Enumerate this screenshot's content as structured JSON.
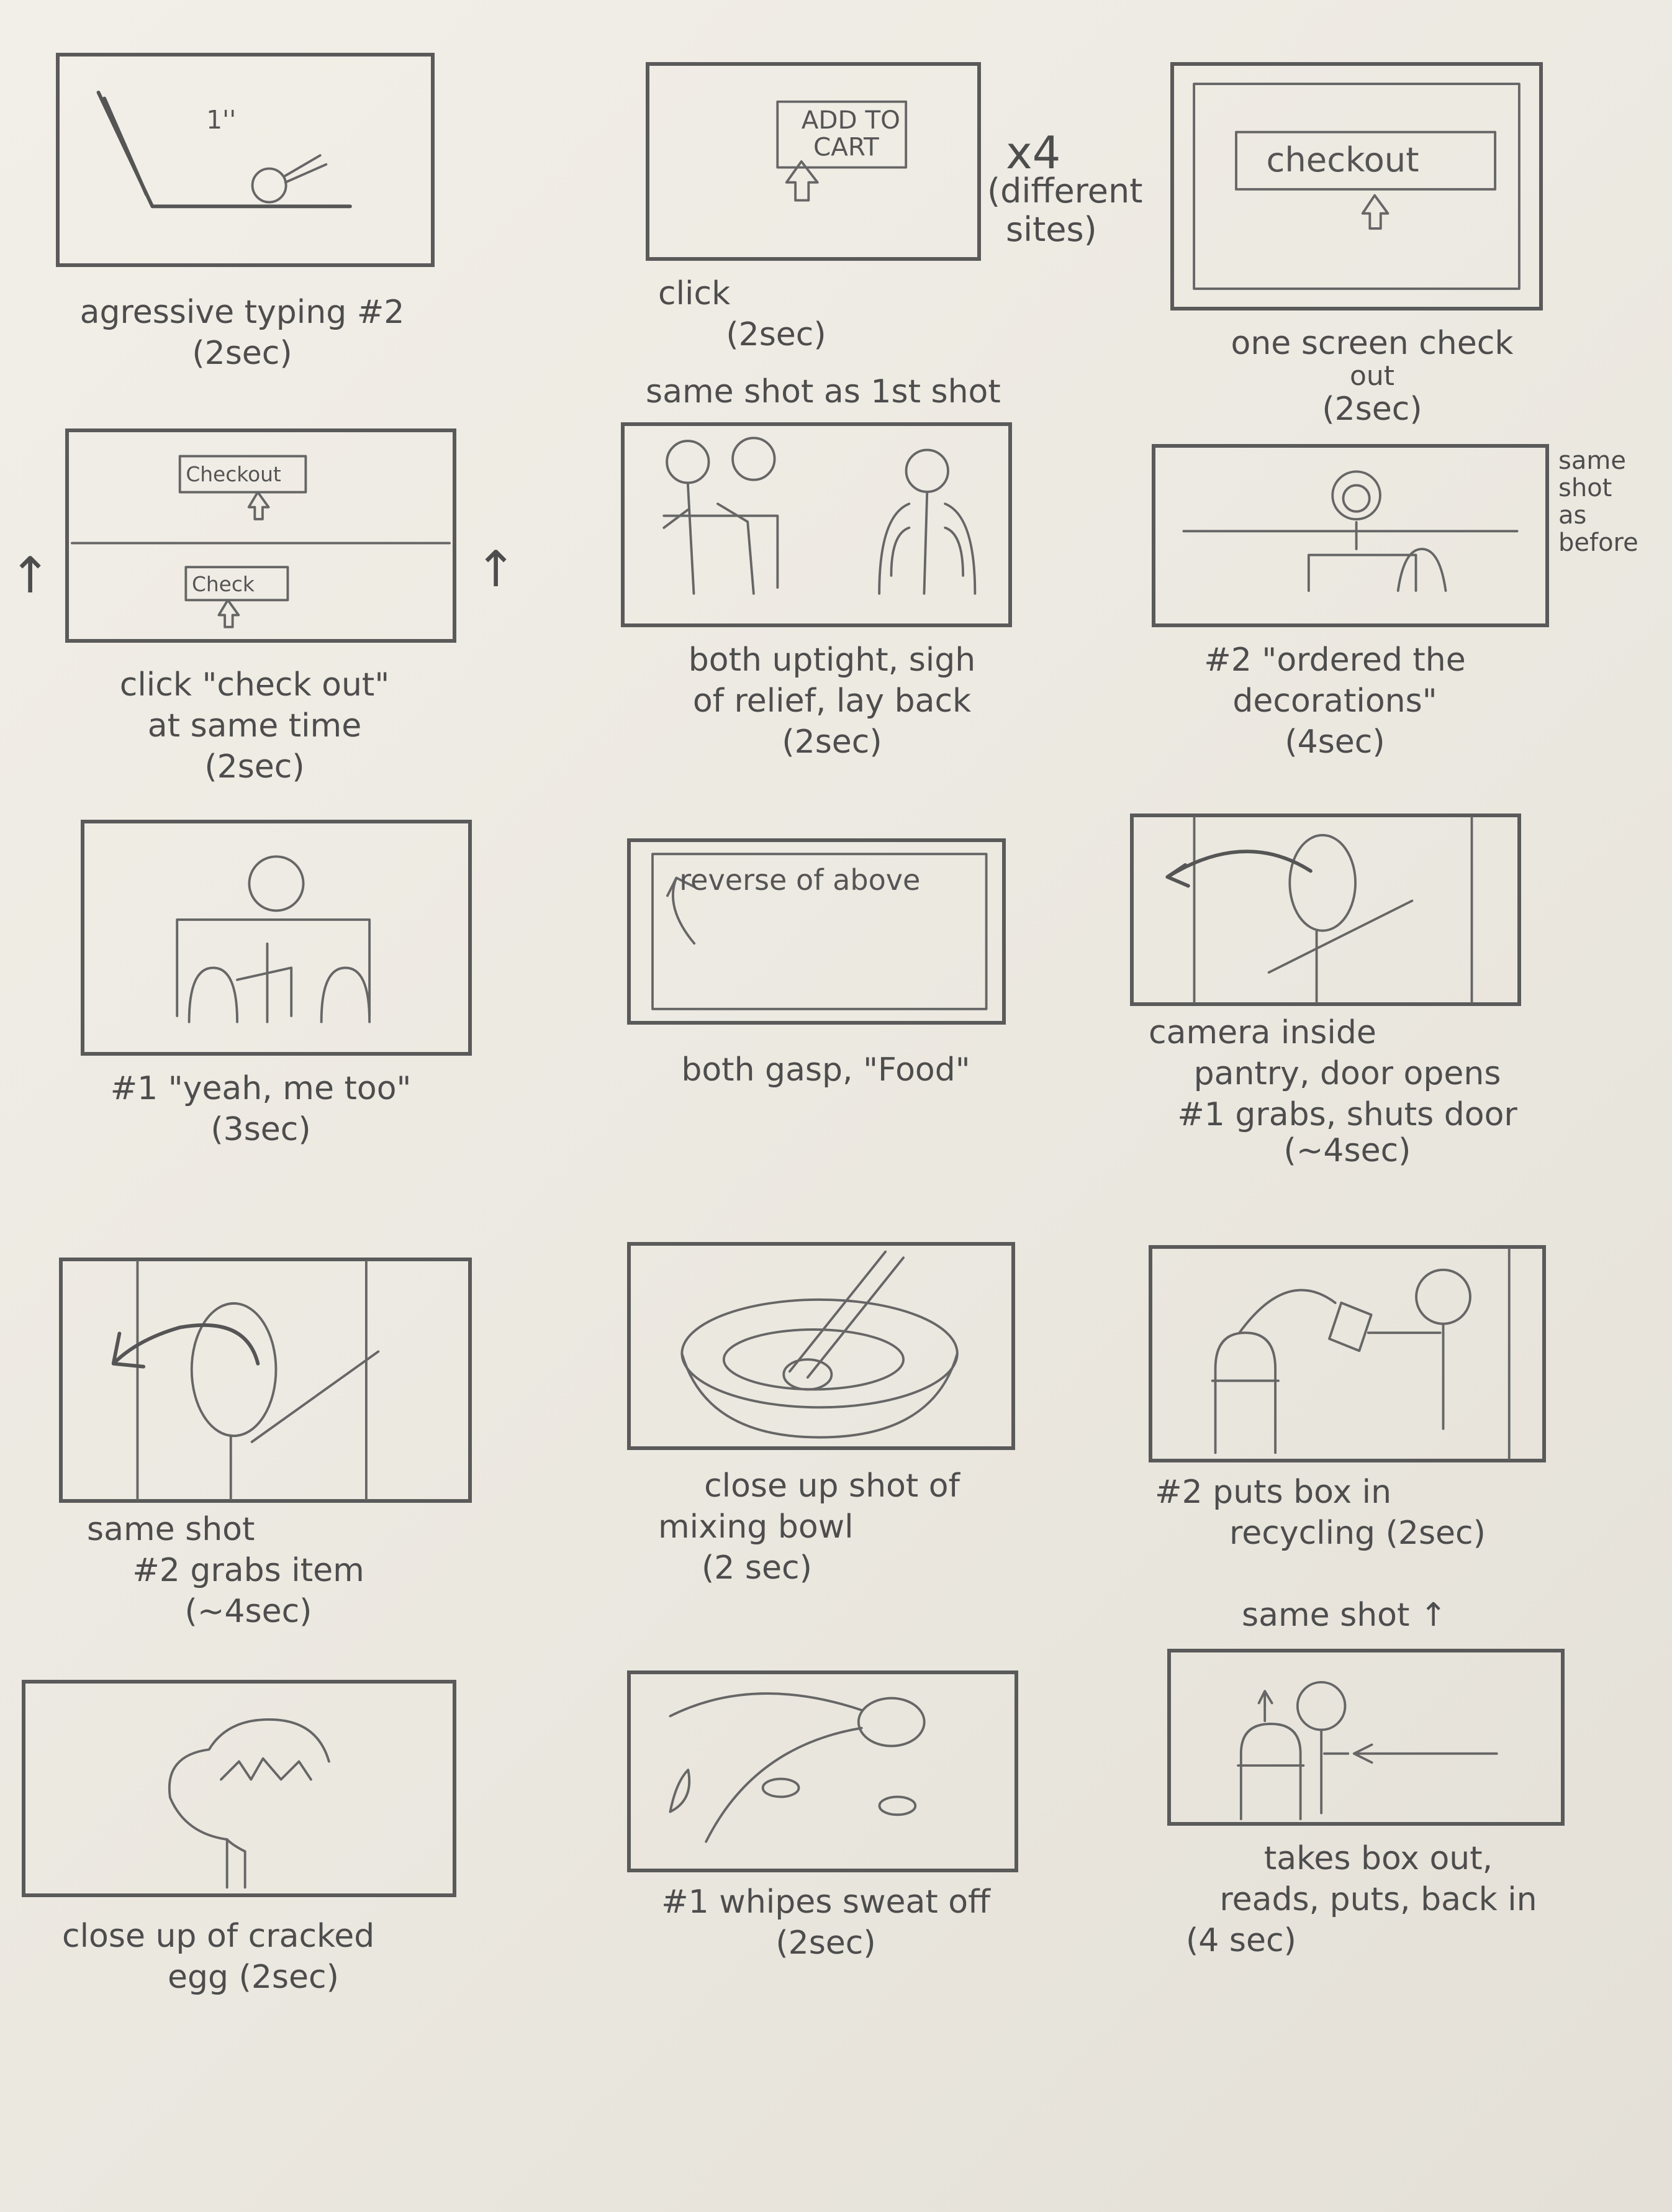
{
  "panels": [
    {
      "caption": [
        "agressive typing #2",
        "(2sec)"
      ],
      "inner": [
        "1''"
      ]
    },
    {
      "caption": [
        "click",
        "(2sec)"
      ],
      "inner": [
        "ADD TO",
        "CART"
      ],
      "side": [
        "x4",
        "(different",
        "sites)"
      ]
    },
    {
      "caption": [
        "one screen check",
        "out",
        "(2sec)"
      ],
      "inner": [
        "checkout"
      ]
    },
    {
      "caption": [
        "click \"check out\"",
        "at same time",
        "(2sec)"
      ],
      "inner": [
        "Checkout",
        "Check"
      ]
    },
    {
      "caption": [
        "both uptight, sigh",
        "of relief, lay back",
        "(2sec)"
      ],
      "above": "same shot as 1st shot"
    },
    {
      "caption": [
        "#2 \"ordered the",
        "decorations\"",
        "(4sec)"
      ],
      "side": [
        "same",
        "shot",
        "as",
        "before"
      ]
    },
    {
      "caption": [
        "#1 \"yeah, me too\"",
        "(3sec)"
      ]
    },
    {
      "caption": [
        "both gasp, \"Food\""
      ],
      "inner": [
        "reverse of above"
      ]
    },
    {
      "caption": [
        "camera inside",
        "pantry, door opens",
        "#1 grabs, shuts door",
        "(~4sec)"
      ]
    },
    {
      "caption": [
        "same shot",
        "#2 grabs item",
        "(~4sec)"
      ]
    },
    {
      "caption": [
        "close up shot of",
        "mixing bowl",
        "(2 sec)"
      ]
    },
    {
      "caption": [
        "#2 puts box in",
        "recycling (2sec)"
      ]
    },
    {
      "caption": [
        "close up of cracked",
        "egg (2sec)"
      ]
    },
    {
      "caption": [
        "#1 whipes sweat off",
        "(2sec)"
      ]
    },
    {
      "caption": [
        "takes box out,",
        "reads, puts, back in",
        "(4 sec)"
      ],
      "above": "same shot ↑"
    }
  ]
}
